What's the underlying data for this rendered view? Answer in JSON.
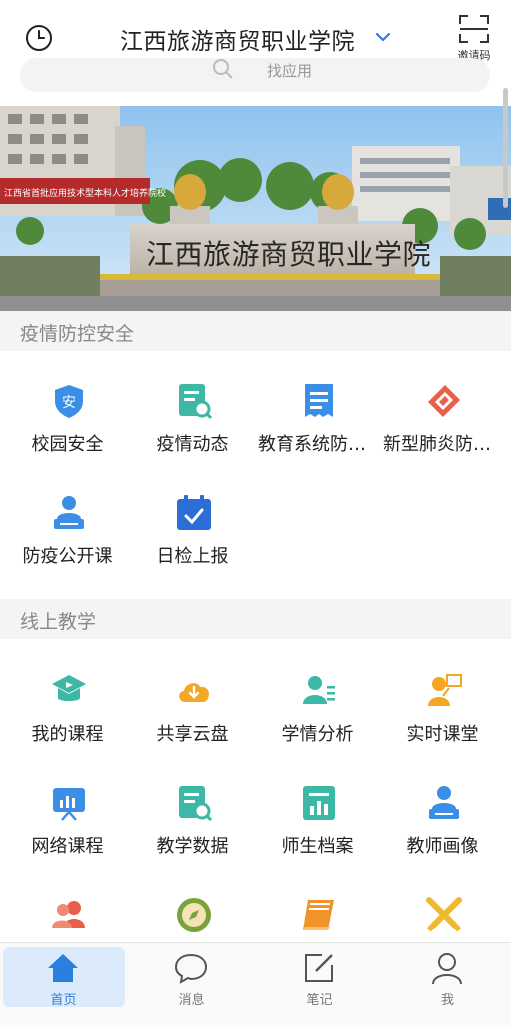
{
  "header": {
    "title": "江西旅游商贸职业学院",
    "invite_label": "邀请码"
  },
  "search": {
    "placeholder": "找应用"
  },
  "banner": {
    "school_sign": "江西旅游商贸职业学院",
    "red_sign": "江西省首批应用技术型本科人才培养院校"
  },
  "sections": [
    {
      "title": "疫情防控安全",
      "items": [
        {
          "label": "校园安全",
          "icon": "shield-icon"
        },
        {
          "label": "疫情动态",
          "icon": "document-search-icon"
        },
        {
          "label": "教育系统防疫知识",
          "icon": "receipt-icon"
        },
        {
          "label": "新型肺炎防控指南",
          "icon": "tag-icon"
        },
        {
          "label": "防疫公开课",
          "icon": "lecturer-icon"
        },
        {
          "label": "日检上报",
          "icon": "calendar-check-icon"
        }
      ]
    },
    {
      "title": "线上教学",
      "items": [
        {
          "label": "我的课程",
          "icon": "course-cap-icon"
        },
        {
          "label": "共享云盘",
          "icon": "cloud-download-icon"
        },
        {
          "label": "学情分析",
          "icon": "user-list-icon"
        },
        {
          "label": "实时课堂",
          "icon": "teacher-board-icon"
        },
        {
          "label": "网络课程",
          "icon": "presentation-icon"
        },
        {
          "label": "教学数据",
          "icon": "document-search-icon"
        },
        {
          "label": "师生档案",
          "icon": "bar-chart-icon"
        },
        {
          "label": "教师画像",
          "icon": "lecturer-icon"
        },
        {
          "label": "",
          "icon": "people-icon"
        },
        {
          "label": "",
          "icon": "compass-icon"
        },
        {
          "label": "",
          "icon": "book-icon"
        },
        {
          "label": "",
          "icon": "crossed-swords-icon"
        }
      ]
    }
  ],
  "tabs": [
    {
      "label": "首页",
      "icon": "home-icon",
      "active": true
    },
    {
      "label": "消息",
      "icon": "chat-bubble-icon",
      "active": false
    },
    {
      "label": "笔记",
      "icon": "edit-note-icon",
      "active": false
    },
    {
      "label": "我",
      "icon": "person-icon",
      "active": false
    }
  ],
  "colors": {
    "accent": "#2b7fe0",
    "section_bg": "#f3f4f6",
    "teal": "#3db8a6",
    "orange": "#f5a623",
    "red": "#e8604a",
    "blue": "#3a8ee6"
  }
}
